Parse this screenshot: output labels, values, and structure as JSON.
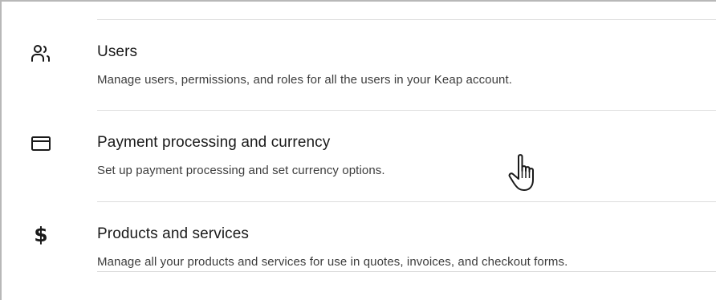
{
  "settings_list": {
    "items": [
      {
        "icon": "users-icon",
        "title": "Users",
        "description": "Manage users, permissions, and roles for all the users in your Keap account."
      },
      {
        "icon": "credit-card-icon",
        "title": "Payment processing and currency",
        "description": "Set up payment processing and set currency options."
      },
      {
        "icon": "dollar-icon",
        "title": "Products and services",
        "description": "Manage all your products and services for use in quotes, invoices, and checkout forms."
      }
    ]
  },
  "colors": {
    "text_primary": "#1a1a1a",
    "text_secondary": "#3d3d3d",
    "divider": "#dddddd",
    "frame_border": "#b8b8b8"
  }
}
